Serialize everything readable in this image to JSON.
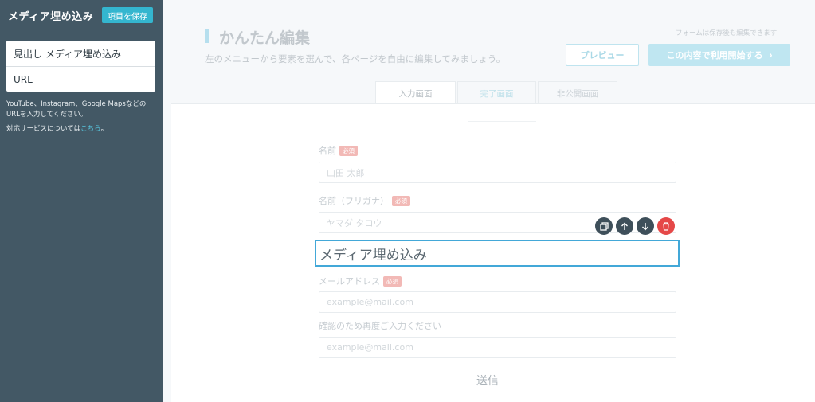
{
  "sidebar": {
    "title": "メディア埋め込み",
    "save_label": "項目を保存",
    "fields": [
      {
        "label": "見出し メディア埋め込み"
      },
      {
        "label": "URL"
      }
    ],
    "help_line1": "YouTube、Instagram、Google Mapsなどの",
    "help_line2": "URLを入力してください。",
    "services_prefix": "対応サービスについては",
    "services_link": "こちら",
    "services_suffix": "。"
  },
  "header": {
    "title": "かんたん編集",
    "subtitle": "左のメニューから要素を選んで、各ページを自由に編集してみましょう。",
    "saved_note": "フォームは保存後も編集できます",
    "preview_label": "プレビュー",
    "start_label": "この内容で利用開始する",
    "start_chevron": "›"
  },
  "tabs": [
    {
      "label": "入力画面"
    },
    {
      "label": "完了画面"
    },
    {
      "label": "非公開画面"
    }
  ],
  "form": {
    "required_badge": "必須",
    "name_label": "名前",
    "name_placeholder": "山田 太郎",
    "kana_label": "名前（フリガナ）",
    "kana_placeholder": "ヤマダ タロウ",
    "media_heading": "メディア埋め込み",
    "email_label": "メールアドレス",
    "email_placeholder": "example@mail.com",
    "confirm_label": "確認のため再度ご入力ください",
    "confirm_placeholder": "example@mail.com",
    "submit_label": "送信"
  },
  "tools": {
    "copy_icon": "copy-icon",
    "up_icon": "arrow-up-icon",
    "down_icon": "arrow-down-icon",
    "delete_icon": "trash-icon"
  },
  "colors": {
    "sidebar_bg": "#435865",
    "accent": "#34b6cf",
    "selected_border": "#43a8d8",
    "delete": "#e54848"
  }
}
